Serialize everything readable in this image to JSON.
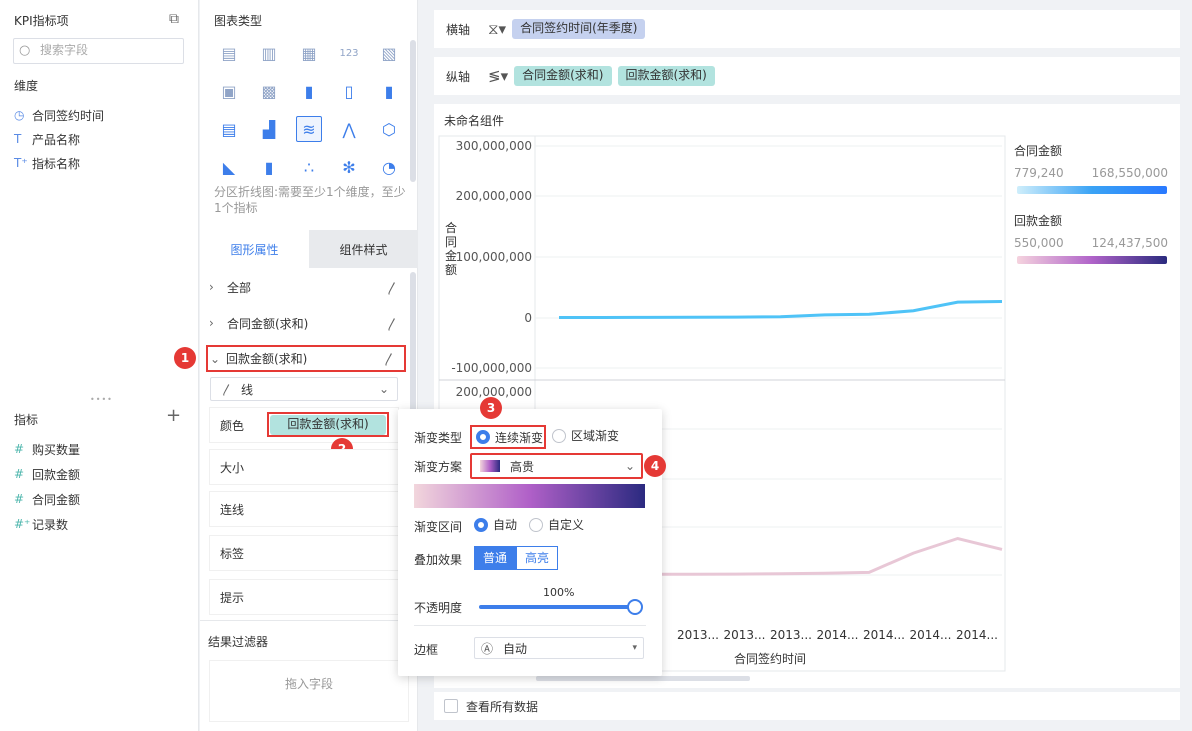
{
  "left": {
    "title": "KPI指标项",
    "search_placeholder": "搜索字段",
    "dimensions_label": "维度",
    "dimensions": [
      {
        "icon": "clock-icon",
        "glyph": "◷",
        "label": "合同签约时间"
      },
      {
        "icon": "text-type-icon",
        "glyph": "T",
        "label": "产品名称"
      },
      {
        "icon": "text-calc-type-icon",
        "glyph": "T⁺",
        "label": "指标名称"
      }
    ],
    "metrics_label": "指标",
    "metrics": [
      {
        "icon": "number-type-icon",
        "glyph": "#",
        "label": "购买数量"
      },
      {
        "icon": "number-type-icon",
        "glyph": "#",
        "label": "回款金额"
      },
      {
        "icon": "number-type-icon",
        "glyph": "#",
        "label": "合同金额"
      },
      {
        "icon": "number-calc-type-icon",
        "glyph": "#⁺",
        "label": "记录数"
      }
    ]
  },
  "middle": {
    "chart_type_title": "图表类型",
    "chart_type_desc": "分区折线图:需要至少1个维度，至少1个指标",
    "tabs": [
      "图形属性",
      "组件样式"
    ],
    "props": [
      {
        "label": "全部",
        "chev": ">"
      },
      {
        "label": "合同金额(求和)",
        "chev": ">"
      },
      {
        "label": "回款金额(求和)",
        "chev": "∨"
      }
    ],
    "line_select": "线",
    "color_label": "颜色",
    "color_pill": "回款金额(求和)",
    "cards": [
      "大小",
      "连线",
      "标签",
      "提示"
    ],
    "filter_title": "结果过滤器",
    "filter_placeholder": "拖入字段"
  },
  "axes": {
    "x_label": "横轴",
    "x_pills": [
      "合同签约时间(年季度)"
    ],
    "y_label": "纵轴",
    "y_pills": [
      "合同金额(求和)",
      "回款金额(求和)"
    ]
  },
  "chart_title": "未命名组件",
  "chart_data": {
    "type": "line",
    "ylabel_top": "合同金额",
    "xlabel": "合同签约时间",
    "top_ticks": [
      "300,000,000",
      "200,000,000",
      "100,000,000",
      "0",
      "-100,000,000"
    ],
    "bottom_ticks": [
      "200,000,000"
    ],
    "x_ticks": [
      "2013...",
      "2013...",
      "2013...",
      "2014...",
      "2014...",
      "2014...",
      "2014..."
    ],
    "series": [
      {
        "name": "合同金额",
        "values": [
          779240,
          900000,
          1000000,
          1200000,
          1500000,
          2000000,
          5000000,
          6000000,
          12000000,
          26000000,
          27000000
        ],
        "color": "#4fc3f7"
      },
      {
        "name": "回款金额",
        "values": [
          550000,
          700000,
          900000,
          1100000,
          1300000,
          1600000,
          2500000,
          3500000,
          30000000,
          50000000,
          35000000
        ],
        "color": "#e8c7d6"
      }
    ]
  },
  "legend": [
    {
      "title": "合同金额",
      "min": "779,240",
      "max": "168,550,000",
      "gradient": [
        "#cfeefb",
        "#3aa3f5",
        "#2979ff"
      ]
    },
    {
      "title": "回款金额",
      "min": "550,000",
      "max": "124,437,500",
      "gradient": [
        "#f5d3de",
        "#b063c9",
        "#2a2a7e"
      ]
    }
  ],
  "popup": {
    "gradient_type_label": "渐变类型",
    "gradient_type_options": [
      "连续渐变",
      "区域渐变"
    ],
    "scheme_label": "渐变方案",
    "scheme_value": "高贵",
    "scheme_gradient": [
      "#f2d6dc",
      "#b060c8",
      "#2b2a80"
    ],
    "range_label": "渐变区间",
    "range_options": [
      "自动",
      "自定义"
    ],
    "overlay_label": "叠加效果",
    "overlay_options": [
      "普通",
      "高亮"
    ],
    "opacity_label": "不透明度",
    "opacity_value": "100%",
    "border_label": "边框",
    "border_value": "自动"
  },
  "footer_check": "查看所有数据",
  "badges": [
    "1",
    "2",
    "3",
    "4"
  ],
  "colors": {
    "accent": "#3d7eea",
    "annotation": "#e53935",
    "teal_pill": "#b2e3df",
    "blue_pill": "#c5d1ef"
  }
}
